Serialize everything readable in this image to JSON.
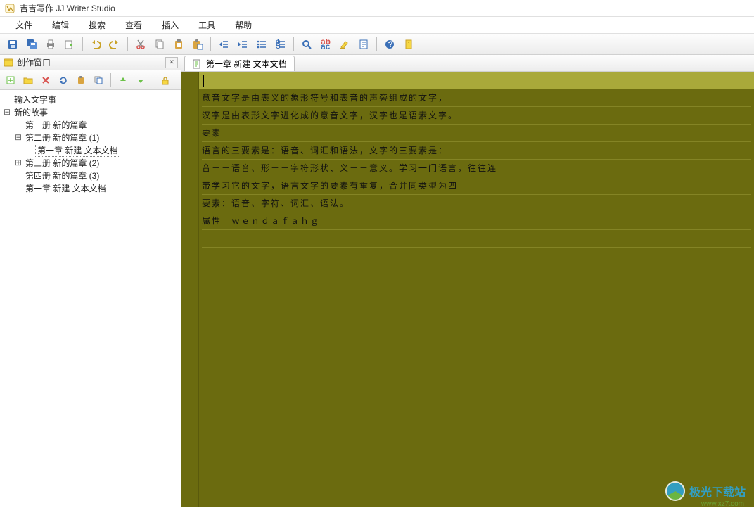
{
  "window": {
    "title": "吉吉写作 JJ Writer Studio"
  },
  "menu": {
    "file": "文件",
    "edit": "编辑",
    "search": "搜索",
    "view": "查看",
    "insert": "插入",
    "tools": "工具",
    "help": "帮助"
  },
  "sidebar": {
    "title": "创作窗口",
    "root": "输入文字事",
    "story": "新的故事",
    "vol1": "第一册 新的篇章",
    "vol2": "第二册 新的篇章 (1)",
    "ch1doc": "第一章 新建 文本文档",
    "vol3": "第三册 新的篇章 (2)",
    "vol4": "第四册 新的篇章 (3)",
    "ch1doc2": "第一章 新建 文本文档"
  },
  "tab": {
    "label": "第一章 新建 文本文档"
  },
  "doc": {
    "l1": "",
    "l2": "意音文字是由表义的象形符号和表音的声旁组成的文字，",
    "l3": "汉字是由表形文字进化成的意音文字，汉字也是语素文字。",
    "l4": "要素",
    "l5": "语言的三要素是：语音、词汇和语法，文字的三要素是：",
    "l6": "音－－语音、形－－字符形状、义－－意义。学习一门语言，往往连",
    "l7": "带学习它的文字，语言文字的要素有重复，合并同类型为四",
    "l8": "要素：语音、字符、词汇、语法。",
    "l9": "属性　ｗｅｎｄａｆａｈｇ"
  },
  "watermark": {
    "brand": "极光下载站",
    "url": "www.xz7.com"
  },
  "icons": {
    "save": "save",
    "saveall": "saveall",
    "print": "print",
    "export": "export",
    "undo": "undo",
    "redo": "redo",
    "cut": "cut",
    "copy": "copy",
    "paste": "paste",
    "clip": "clip",
    "outdent": "outdent",
    "indent": "indent",
    "list": "list",
    "numlist": "numlist",
    "find": "find",
    "replace": "replace",
    "bookmark": "bookmark",
    "macro": "macro",
    "help": "help",
    "settings": "settings",
    "new": "new",
    "open": "open",
    "delete": "delete",
    "refresh": "refresh",
    "rename": "rename",
    "duplicate": "duplicate",
    "nodeup": "up",
    "nodedown": "down",
    "nodeleft": "left",
    "lock": "lock"
  }
}
